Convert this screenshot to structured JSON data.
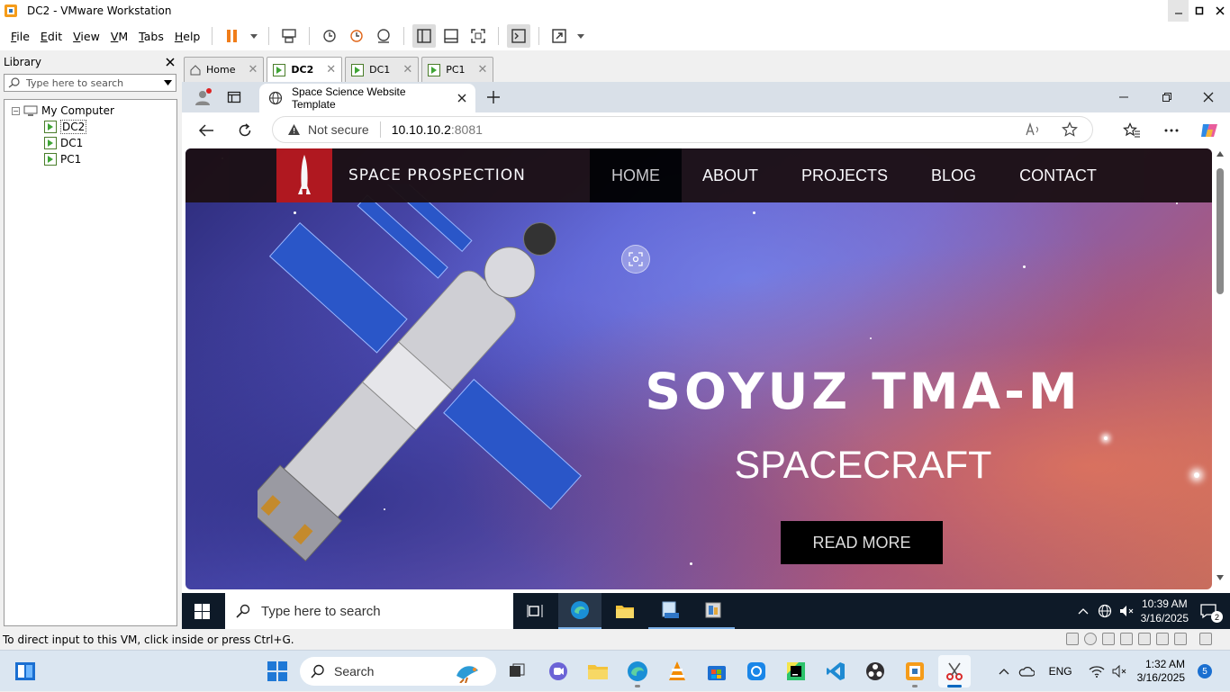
{
  "window": {
    "title": "DC2 - VMware Workstation"
  },
  "menu": {
    "items": [
      {
        "key": "F",
        "rest": "ile"
      },
      {
        "key": "E",
        "rest": "dit"
      },
      {
        "key": "V",
        "rest": "iew"
      },
      {
        "key": "V",
        "rest": "M"
      },
      {
        "key": "T",
        "rest": "abs"
      },
      {
        "key": "H",
        "rest": "elp"
      }
    ]
  },
  "library": {
    "title": "Library",
    "search_placeholder": "Type here to search",
    "root": "My Computer",
    "vms": [
      "DC2",
      "DC1",
      "PC1"
    ],
    "selected": "DC2"
  },
  "vm_tabs": [
    {
      "label": "Home",
      "active": false
    },
    {
      "label": "DC2",
      "active": true
    },
    {
      "label": "DC1",
      "active": false
    },
    {
      "label": "PC1",
      "active": false
    }
  ],
  "browser": {
    "tab_title": "Space Science Website Template",
    "security": "Not secure",
    "url_host": "10.10.10.2",
    "url_port": ":8081"
  },
  "site": {
    "brand": "SPACE PROSPECTION",
    "nav": [
      "HOME",
      "ABOUT",
      "PROJECTS",
      "BLOG",
      "CONTACT"
    ],
    "active_nav": "HOME",
    "hero_title": "SOYUZ TMA-M",
    "hero_subtitle": "SPACECRAFT",
    "cta": "READ MORE",
    "accent": "#b5171c"
  },
  "guest_taskbar": {
    "search_placeholder": "Type here to search",
    "time": "10:39 AM",
    "date": "3/16/2025",
    "notifications": "2"
  },
  "status": {
    "text": "To direct input to this VM, click inside or press Ctrl+G."
  },
  "host_taskbar": {
    "search_placeholder": "Search",
    "lang": "ENG",
    "time": "1:32 AM",
    "date": "3/16/2025",
    "notifications": "5"
  }
}
